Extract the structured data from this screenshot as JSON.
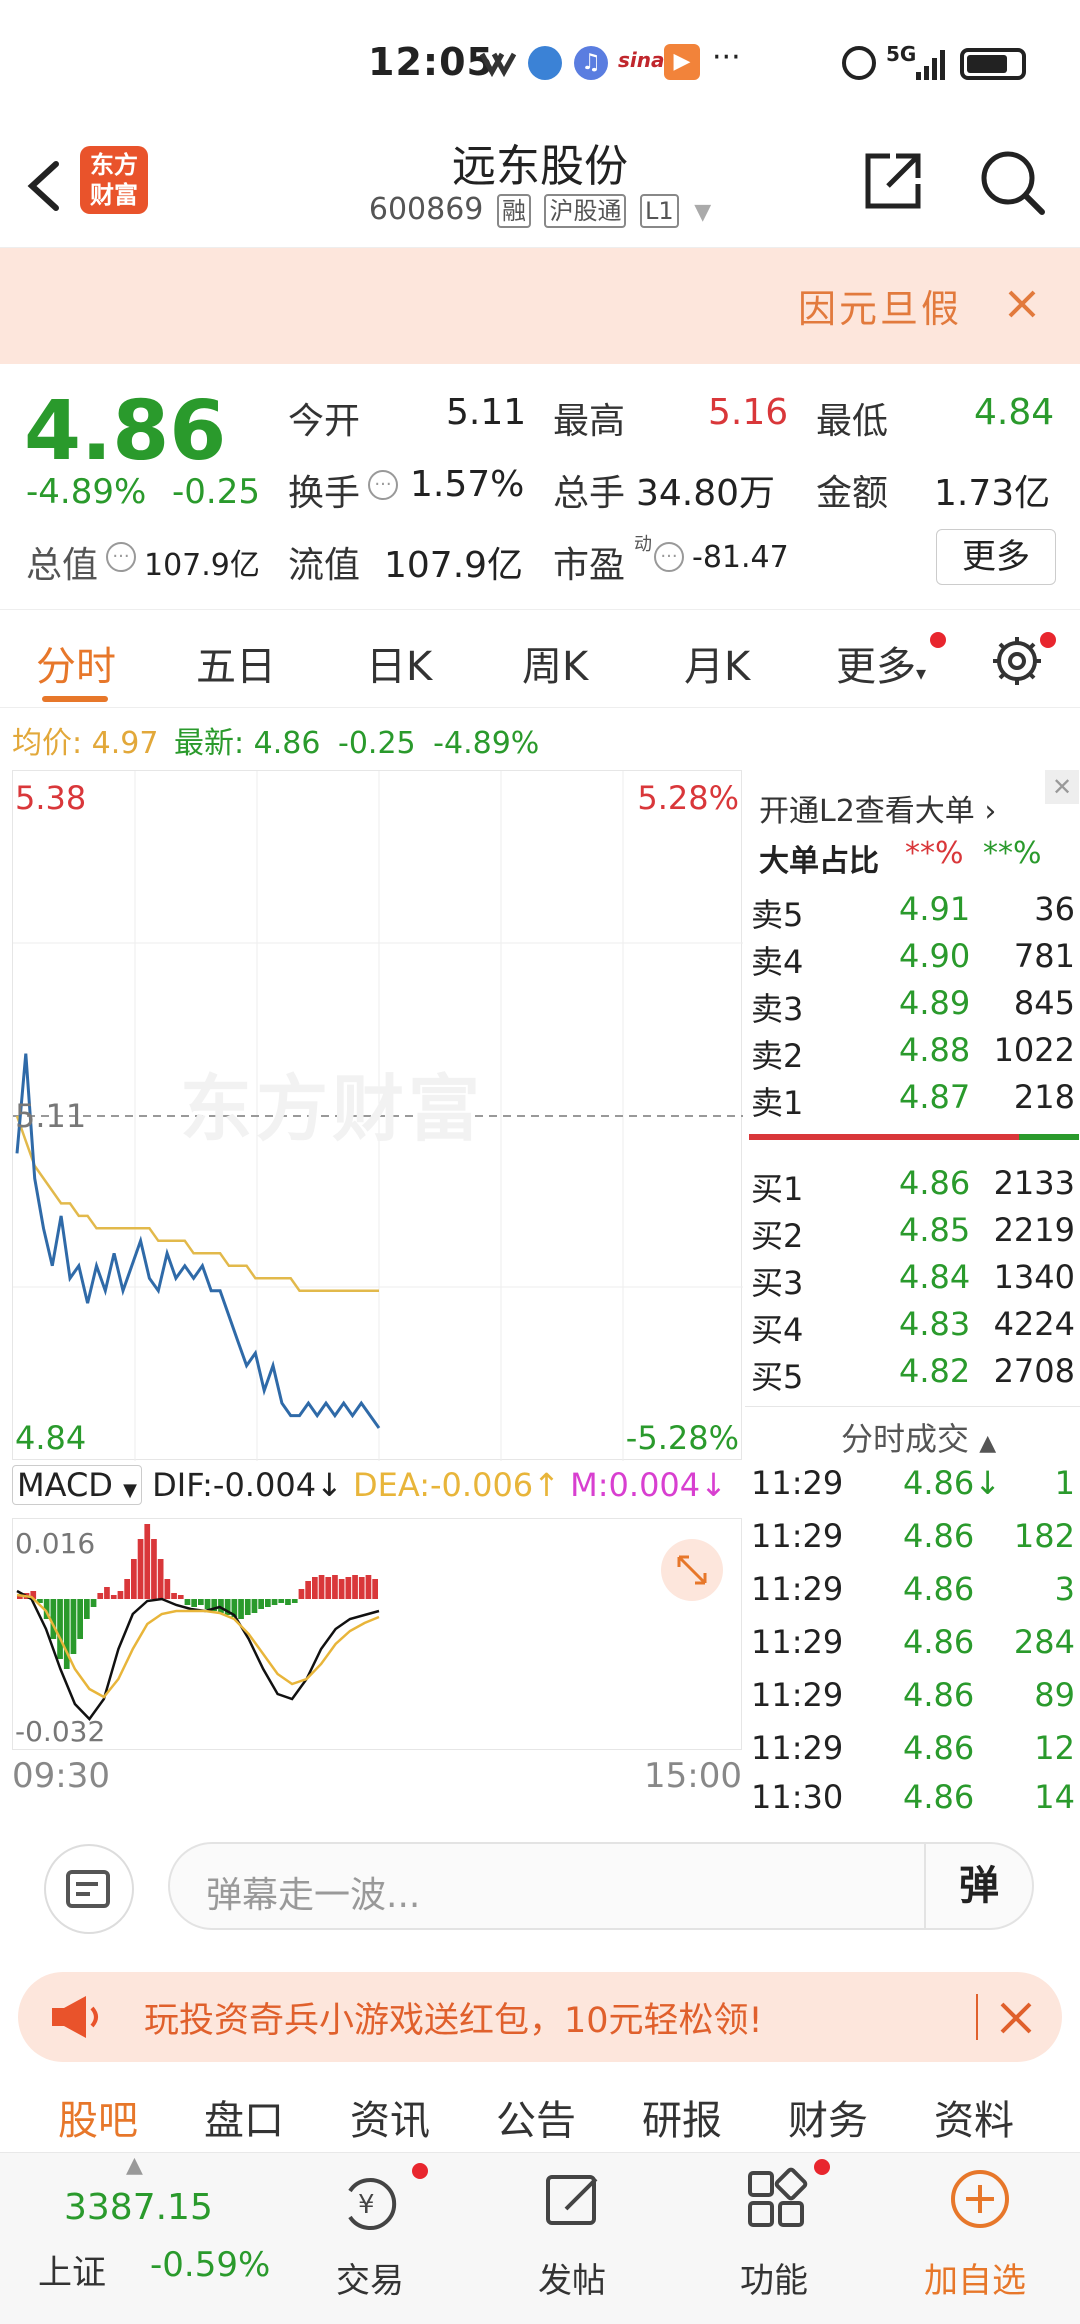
{
  "status_bar": {
    "time": "12:05",
    "network": "5G"
  },
  "header": {
    "logo_text": "东方财富",
    "stock_name": "远东股份",
    "stock_code": "600869",
    "tags": [
      "融",
      "沪股通",
      "L1"
    ]
  },
  "notice": {
    "text": "因元旦假"
  },
  "quote": {
    "price": "4.86",
    "change_pct": "-4.89%",
    "change_abs": "-0.25",
    "fields": {
      "open_label": "今开",
      "open": "5.11",
      "high_label": "最高",
      "high": "5.16",
      "low_label": "最低",
      "low": "4.84",
      "turnover_label": "换手",
      "turnover": "1.57%",
      "volume_label": "总手",
      "volume": "34.80万",
      "amount_label": "金额",
      "amount": "1.73亿",
      "total_mv_label": "总值",
      "total_mv": "107.9亿",
      "float_mv_label": "流值",
      "float_mv": "107.9亿",
      "pe_label": "市盈",
      "pe_sup": "动",
      "pe": "-81.47"
    },
    "more_label": "更多"
  },
  "tabs": [
    "分时",
    "五日",
    "日K",
    "周K",
    "月K",
    "更多"
  ],
  "chart_info": {
    "avg_label": "均价:",
    "avg": "4.97",
    "latest_label": "最新:",
    "latest": "4.86",
    "chg": "-0.25",
    "pct": "-4.89%"
  },
  "chart_data": {
    "type": "line",
    "y_max_label": "5.38",
    "y_min_label": "4.84",
    "pct_max_label": "5.28%",
    "pct_min_label": "-5.28%",
    "ref_label": "5.11",
    "x_start": "09:30",
    "x_end": "15:00",
    "ylim": [
      4.84,
      5.38
    ],
    "price": [
      5.08,
      5.16,
      5.06,
      5.02,
      4.99,
      5.03,
      4.98,
      4.99,
      4.96,
      4.99,
      4.97,
      5.0,
      4.97,
      4.99,
      5.01,
      4.98,
      4.97,
      5.0,
      4.98,
      4.99,
      4.98,
      4.99,
      4.97,
      4.97,
      4.95,
      4.93,
      4.91,
      4.92,
      4.89,
      4.91,
      4.88,
      4.87,
      4.87,
      4.88,
      4.87,
      4.88,
      4.87,
      4.88,
      4.87,
      4.88,
      4.87,
      4.86
    ],
    "avg": [
      5.11,
      5.09,
      5.07,
      5.06,
      5.05,
      5.04,
      5.04,
      5.03,
      5.03,
      5.02,
      5.02,
      5.02,
      5.02,
      5.02,
      5.02,
      5.02,
      5.01,
      5.01,
      5.01,
      5.01,
      5.0,
      5.0,
      5.0,
      5.0,
      4.99,
      4.99,
      4.99,
      4.98,
      4.98,
      4.98,
      4.98,
      4.98,
      4.97,
      4.97,
      4.97,
      4.97,
      4.97,
      4.97,
      4.97,
      4.97,
      4.97,
      4.97
    ],
    "macd": {
      "label": "MACD",
      "dif": "DIF:-0.004",
      "dea": "DEA:-0.006",
      "m": "M:0.004",
      "top_label": "0.016",
      "bottom_label": "-0.032"
    }
  },
  "order_book": {
    "l2_text": "开通L2查看大单",
    "big_order_label": "大单占比",
    "big_buy": "**%",
    "big_sell": "**%",
    "asks": [
      {
        "label": "卖5",
        "price": "4.91",
        "vol": "36"
      },
      {
        "label": "卖4",
        "price": "4.90",
        "vol": "781"
      },
      {
        "label": "卖3",
        "price": "4.89",
        "vol": "845"
      },
      {
        "label": "卖2",
        "price": "4.88",
        "vol": "1022"
      },
      {
        "label": "卖1",
        "price": "4.87",
        "vol": "218"
      }
    ],
    "bids": [
      {
        "label": "买1",
        "price": "4.86",
        "vol": "2133"
      },
      {
        "label": "买2",
        "price": "4.85",
        "vol": "2219"
      },
      {
        "label": "买3",
        "price": "4.84",
        "vol": "1340"
      },
      {
        "label": "买4",
        "price": "4.83",
        "vol": "4224"
      },
      {
        "label": "买5",
        "price": "4.82",
        "vol": "2708"
      }
    ],
    "trades_title": "分时成交",
    "trades": [
      {
        "time": "11:29",
        "price": "4.86↓",
        "vol": "1"
      },
      {
        "time": "11:29",
        "price": "4.86",
        "vol": "182"
      },
      {
        "time": "11:29",
        "price": "4.86",
        "vol": "3"
      },
      {
        "time": "11:29",
        "price": "4.86",
        "vol": "284"
      },
      {
        "time": "11:29",
        "price": "4.86",
        "vol": "89"
      },
      {
        "time": "11:29",
        "price": "4.86",
        "vol": "12"
      },
      {
        "time": "11:30",
        "price": "4.86",
        "vol": "14"
      }
    ]
  },
  "danmaku": {
    "placeholder": "弹幕走一波...",
    "send_label": "弹"
  },
  "promo": {
    "text": "玩投资奇兵小游戏送红包，10元轻松领!"
  },
  "bottom_tabs": [
    "股吧",
    "盘口",
    "资讯",
    "公告",
    "研报",
    "财务",
    "资料"
  ],
  "bottom_bar": {
    "index_value": "3387.15",
    "index_name": "上证",
    "index_pct": "-0.59%",
    "trade_label": "交易",
    "post_label": "发帖",
    "func_label": "功能",
    "add_label": "加自选"
  },
  "colors": {
    "up": "#d9373a",
    "down": "#2a9a2c",
    "accent": "#e7772a",
    "price_line": "#2f6aa8",
    "avg_line": "#e2b94b"
  }
}
